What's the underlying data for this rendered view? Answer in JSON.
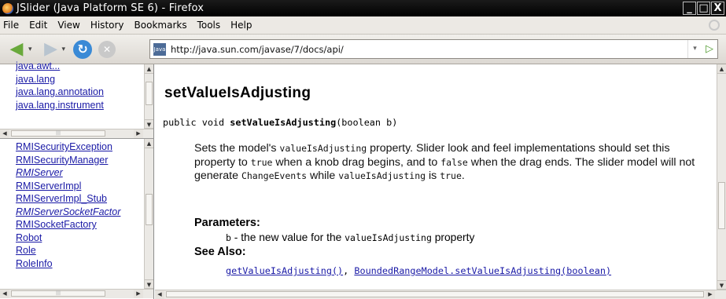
{
  "window": {
    "title": "JSlider (Java Platform SE 6) - Firefox",
    "buttons": [
      "_",
      "□",
      "X"
    ]
  },
  "menubar": {
    "items": [
      "File",
      "Edit",
      "View",
      "History",
      "Bookmarks",
      "Tools",
      "Help"
    ]
  },
  "navbar": {
    "url": "http://java.sun.com/javase/7/docs/api/",
    "site_icon_text": "Java"
  },
  "packages_frame": {
    "items": [
      "java.awt...",
      "java.lang",
      "java.lang.annotation",
      "java.lang.instrument"
    ]
  },
  "classes_frame": {
    "items": [
      {
        "label": "RMISecurityException",
        "italic": false
      },
      {
        "label": "RMISecurityManager",
        "italic": false
      },
      {
        "label": "RMIServer",
        "italic": true
      },
      {
        "label": "RMIServerImpl",
        "italic": false
      },
      {
        "label": "RMIServerImpl_Stub",
        "italic": false
      },
      {
        "label": "RMIServerSocketFactor",
        "italic": true
      },
      {
        "label": "RMISocketFactory",
        "italic": false
      },
      {
        "label": "Robot",
        "italic": false
      },
      {
        "label": "Role",
        "italic": false
      },
      {
        "label": "RoleInfo",
        "italic": false
      }
    ]
  },
  "doc": {
    "method_title": "setValueIsAdjusting",
    "signature_prefix": "public void ",
    "signature_name": "setValueIsAdjusting",
    "signature_suffix": "(boolean b)",
    "desc": {
      "t1": "Sets the model's ",
      "c1": "valueIsAdjusting",
      "t2": " property. Slider look and feel implementations should set this property to ",
      "c2": "true",
      "t3": " when a knob drag begins, and to ",
      "c3": "false",
      "t4": " when the drag ends. The slider model will not generate ",
      "c4": "ChangeEvents",
      "t5": " while ",
      "c5": "valueIsAdjusting",
      "t6": " is ",
      "c6": "true",
      "t7": "."
    },
    "parameters_heading": "Parameters:",
    "param_name": "b",
    "param_text": " - the new value for the ",
    "param_code": "valueIsAdjusting",
    "param_tail": " property",
    "see_also_heading": "See Also:",
    "see_also_links": [
      "getValueIsAdjusting()",
      "BoundedRangeModel.setValueIsAdjusting(boolean)"
    ],
    "see_also_sep": ", "
  }
}
